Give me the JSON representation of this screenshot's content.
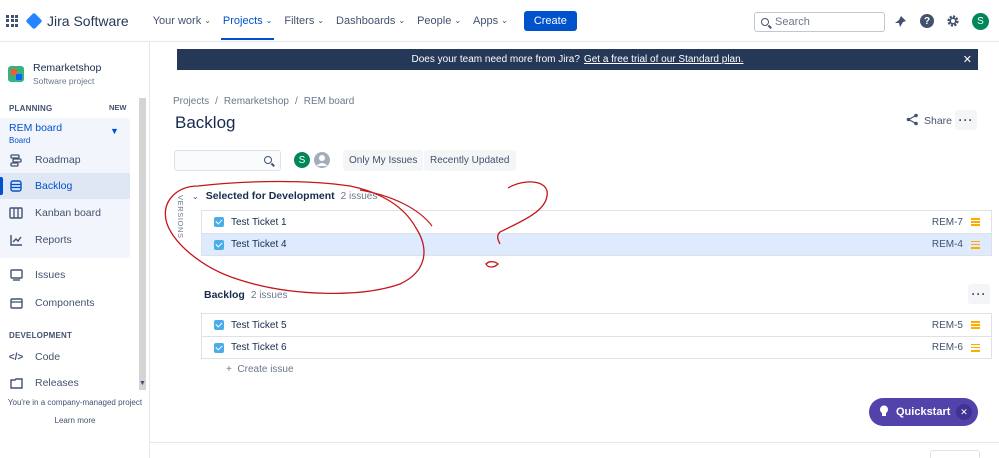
{
  "topnav": {
    "product": "Jira Software",
    "items": [
      {
        "label": "Your work",
        "chevron": true
      },
      {
        "label": "Projects",
        "chevron": true,
        "active": true
      },
      {
        "label": "Filters",
        "chevron": true
      },
      {
        "label": "Dashboards",
        "chevron": true
      },
      {
        "label": "People",
        "chevron": true
      },
      {
        "label": "Apps",
        "chevron": true
      }
    ],
    "create_label": "Create",
    "search_placeholder": "Search",
    "user_initial": "S"
  },
  "sidebar": {
    "project_name": "Remarketshop",
    "project_type": "Software project",
    "planning_label": "PLANNING",
    "new_badge": "NEW",
    "board_name": "REM board",
    "board_type": "Board",
    "planning_items": [
      "Roadmap",
      "Backlog",
      "Kanban board",
      "Reports"
    ],
    "other_items": [
      "Issues",
      "Components"
    ],
    "development_label": "DEVELOPMENT",
    "development_items": [
      "Code",
      "Releases"
    ],
    "footer_text": "You're in a company-managed project",
    "learn_more": "Learn more"
  },
  "banner": {
    "text": "Does your team need more from Jira?",
    "link": "Get a free trial of our Standard plan."
  },
  "breadcrumb": [
    "Projects",
    "Remarketshop",
    "REM board"
  ],
  "page_title": "Backlog",
  "share_label": "Share",
  "toolbar": {
    "avatar_initial": "S",
    "only_my_issues": "Only My Issues",
    "recently_updated": "Recently Updated"
  },
  "versions_label": "VERSIONS",
  "sprint": {
    "title": "Selected for Development",
    "count": "2 issues",
    "issues": [
      {
        "summary": "Test Ticket 1",
        "key": "REM-7",
        "selected": false
      },
      {
        "summary": "Test Ticket 4",
        "key": "REM-4",
        "selected": true
      }
    ]
  },
  "backlog": {
    "title": "Backlog",
    "count": "2 issues",
    "issues": [
      {
        "summary": "Test Ticket 5",
        "key": "REM-5"
      },
      {
        "summary": "Test Ticket 6",
        "key": "REM-6"
      }
    ],
    "create_issue": "Create issue"
  },
  "quickstart_label": "Quickstart",
  "colors": {
    "brand_blue": "#0052cc",
    "banner_bg": "#253858",
    "quickstart_bg": "#5243aa",
    "annotation_red": "#c4161c",
    "priority_medium": "#ffab00",
    "story_icon": "#4bade8"
  }
}
